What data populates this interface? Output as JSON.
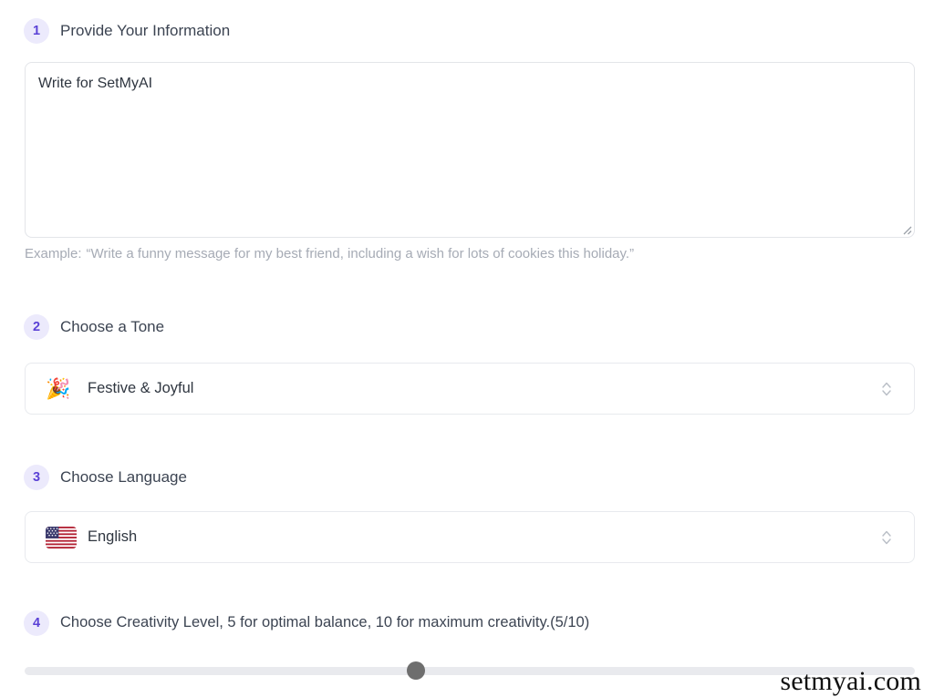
{
  "steps": [
    {
      "number": "1",
      "title": "Provide Your Information"
    },
    {
      "number": "2",
      "title": "Choose a Tone"
    },
    {
      "number": "3",
      "title": "Choose Language"
    },
    {
      "number": "4",
      "title": "Choose Creativity Level, 5 for optimal balance, 10 for maximum creativity.(5/10)"
    }
  ],
  "prompt": {
    "value": "Write for SetMyAI",
    "placeholder": "Write for SetMyAI",
    "resize_icon": "resize-grip-icon"
  },
  "example": {
    "label": "Example:",
    "text": "“Write a funny message for my best friend, including a wish for lots of cookies this holiday.”"
  },
  "tone_select": {
    "icon": "party-popper-emoji",
    "emoji": "🎉",
    "value": "Festive & Joyful",
    "chevron_icon": "chevron-up-down-icon"
  },
  "language_select": {
    "icon": "us-flag-emoji",
    "value": "English",
    "chevron_icon": "chevron-up-down-icon"
  },
  "creativity_slider": {
    "value": 5,
    "min": 0,
    "max": 10,
    "display": "(5/10)",
    "thumb_percent": 44
  },
  "watermark": {
    "text": "setmyai.com"
  },
  "colors": {
    "badge_bg": "#eceafc",
    "badge_text": "#5b42d6",
    "heading_text": "#3c4452",
    "body_text": "#2f3640",
    "muted_text": "#a6abb5",
    "border": "#e3e5e9",
    "track": "#e9eaee",
    "thumb": "#6e6e6e",
    "background": "#ffffff"
  }
}
